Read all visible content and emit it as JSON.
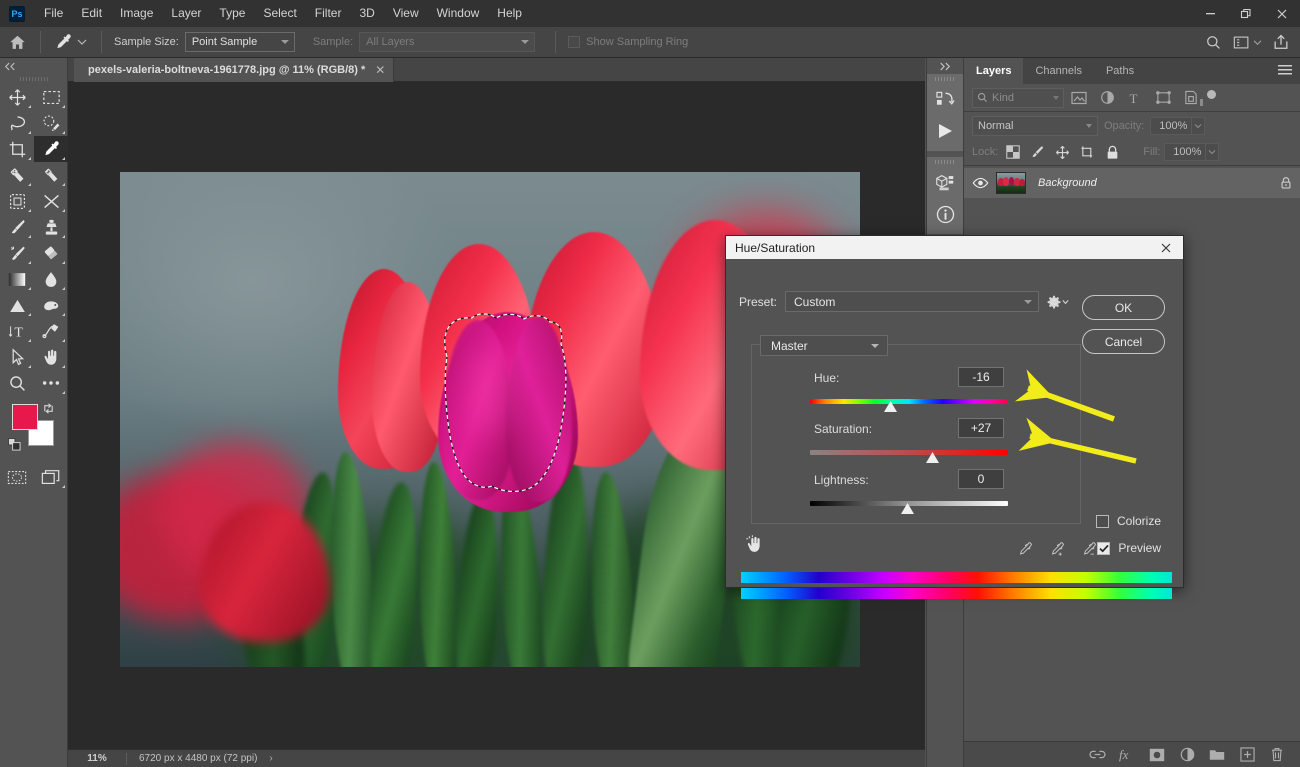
{
  "app": {
    "name": "Ps",
    "menus": [
      "File",
      "Edit",
      "Image",
      "Layer",
      "Type",
      "Select",
      "Filter",
      "3D",
      "View",
      "Window",
      "Help"
    ],
    "window_buttons": {
      "minimize": "minimize-icon",
      "restore": "restore-icon",
      "close": "close-icon"
    }
  },
  "options_bar": {
    "home_icon": "home-icon",
    "tool_icon": "eyedropper-icon",
    "tool_caret": "chevron-down-icon",
    "sample_size_label": "Sample Size:",
    "sample_size_value": "Point Sample",
    "sample_label": "Sample:",
    "sample_value": "All Layers",
    "show_sampling_ring_label": "Show Sampling Ring",
    "show_sampling_ring_checked": false,
    "right_icons": [
      "search-icon",
      "workspace-icon",
      "share-icon"
    ]
  },
  "toolbar": {
    "collapse_icon": "collapse-left-icon",
    "tools": [
      {
        "name": "move-tool",
        "icon": "move-icon",
        "active": false
      },
      {
        "name": "rectangular-marquee-tool",
        "icon": "marquee-icon",
        "active": false
      },
      {
        "name": "lasso-tool",
        "icon": "lasso-icon",
        "active": false
      },
      {
        "name": "object-selection-tool",
        "icon": "quick-selection-icon",
        "active": false
      },
      {
        "name": "crop-tool",
        "icon": "crop-icon",
        "active": false
      },
      {
        "name": "eyedropper-tool",
        "icon": "eyedropper-icon",
        "active": true
      },
      {
        "name": "spot-healing-brush-tool",
        "icon": "healing-brush-icon",
        "active": false
      },
      {
        "name": "patch-tool",
        "icon": "patch-icon",
        "active": false
      },
      {
        "name": "frame-tool",
        "icon": "frame-icon",
        "active": false
      },
      {
        "name": "shuffle-tool",
        "icon": "shuffle-icon",
        "active": false
      },
      {
        "name": "brush-tool",
        "icon": "brush-icon",
        "active": false
      },
      {
        "name": "clone-stamp-tool",
        "icon": "stamp-icon",
        "active": false
      },
      {
        "name": "mixer-brush-tool",
        "icon": "mixer-brush-icon",
        "active": false
      },
      {
        "name": "eraser-tool",
        "icon": "eraser-icon",
        "active": false
      },
      {
        "name": "gradient-tool",
        "icon": "gradient-icon",
        "active": false
      },
      {
        "name": "blur-tool",
        "icon": "blur-drop-icon",
        "active": false
      },
      {
        "name": "dodge-tool",
        "icon": "dodge-triangle-icon",
        "active": false
      },
      {
        "name": "burn-tool",
        "icon": "burn-hand-icon",
        "active": false
      },
      {
        "name": "type-tool",
        "icon": "type-icon",
        "active": false
      },
      {
        "name": "pen-tool",
        "icon": "pen-icon",
        "active": false
      },
      {
        "name": "path-selection-tool",
        "icon": "path-arrow-icon",
        "active": false
      },
      {
        "name": "hand-tool",
        "icon": "hand-icon",
        "active": false
      },
      {
        "name": "zoom-tool",
        "icon": "magnifier-icon",
        "active": false
      },
      {
        "name": "edit-toolbar",
        "icon": "ellipsis-icon",
        "active": false
      },
      {
        "name": "quick-mask-tool",
        "icon": "quick-mask-icon",
        "active": false
      },
      {
        "name": "screen-mode-tool",
        "icon": "screen-mode-icon",
        "active": false
      }
    ],
    "foreground_color": "#e8184c",
    "background_color": "#ffffff",
    "swap_icon": "swap-colors-icon",
    "default_icon": "default-colors-icon"
  },
  "document": {
    "tab_title": "pexels-valeria-boltneva-1961778.jpg @ 11% (RGB/8) *",
    "tab_close_icon": "close-icon"
  },
  "status_bar": {
    "zoom": "11%",
    "dimensions": "6720 px x 4480 px (72 ppi)",
    "expand_icon": "chevron-right-icon"
  },
  "rail": {
    "collapse_icon": "collapse-right-icon",
    "items": [
      {
        "name": "rail-libraries",
        "icon": "actions-icon"
      },
      {
        "name": "rail-play",
        "icon": "play-icon"
      },
      {
        "name": "rail-3d",
        "icon": "cube-icon"
      },
      {
        "name": "rail-info",
        "icon": "info-icon"
      },
      {
        "name": "rail-properties",
        "icon": "properties-icon"
      }
    ]
  },
  "layers_panel": {
    "tabs": [
      {
        "label": "Layers",
        "active": true
      },
      {
        "label": "Channels",
        "active": false
      },
      {
        "label": "Paths",
        "active": false
      }
    ],
    "menu_icon": "panel-menu-icon",
    "filter": {
      "search_icon": "search-icon",
      "kind_label": "Kind",
      "buttons": [
        "pixel-filter-icon",
        "adjustment-filter-icon",
        "type-filter-icon",
        "shape-filter-icon",
        "smart-object-filter-icon"
      ],
      "toggle_icon": "filter-toggle-icon"
    },
    "blend_mode": "Normal",
    "opacity_label": "Opacity:",
    "opacity_value": "100%",
    "lock_label": "Lock:",
    "lock_buttons": [
      "lock-transparency-icon",
      "lock-image-icon",
      "lock-position-icon",
      "lock-artboard-icon",
      "lock-all-icon"
    ],
    "fill_label": "Fill:",
    "fill_value": "100%",
    "layers": [
      {
        "name": "Background",
        "visible": true,
        "locked": true,
        "visibility_icon": "eye-icon",
        "lock_icon": "lock-icon"
      }
    ],
    "footer_buttons": [
      {
        "name": "link-layers-button",
        "icon": "link-icon"
      },
      {
        "name": "layer-style-button",
        "icon": "fx-icon"
      },
      {
        "name": "layer-mask-button",
        "icon": "mask-icon"
      },
      {
        "name": "adjustment-layer-button",
        "icon": "half-circle-icon"
      },
      {
        "name": "new-group-button",
        "icon": "folder-icon"
      },
      {
        "name": "new-layer-button",
        "icon": "plus-square-icon"
      },
      {
        "name": "delete-layer-button",
        "icon": "trash-icon"
      }
    ]
  },
  "dialog": {
    "title": "Hue/Saturation",
    "close_icon": "close-icon",
    "preset_label": "Preset:",
    "preset_value": "Custom",
    "preset_gear_icon": "gear-icon",
    "ok_label": "OK",
    "cancel_label": "Cancel",
    "channel_value": "Master",
    "sliders": [
      {
        "name": "hue",
        "label": "Hue:",
        "value": "-16",
        "thumb_pct": 41
      },
      {
        "name": "saturation",
        "label": "Saturation:",
        "value": "+27",
        "thumb_pct": 62
      },
      {
        "name": "lightness",
        "label": "Lightness:",
        "value": "0",
        "thumb_pct": 49
      }
    ],
    "target_adjust_icon": "on-image-adjust-icon",
    "eyedroppers": [
      "eyedropper-icon",
      "eyedropper-plus-icon",
      "eyedropper-minus-icon"
    ],
    "colorize_label": "Colorize",
    "colorize_checked": false,
    "preview_label": "Preview",
    "preview_checked": true
  },
  "annotations": {
    "arrow_color": "#f2ec1b",
    "arrows": [
      {
        "name": "arrow-to-hue-slider"
      },
      {
        "name": "arrow-to-saturation-slider"
      }
    ]
  },
  "colors": {
    "chrome": "#535353",
    "menubar": "#323232",
    "canvas": "#2a2a2a",
    "accent_blue": "#31a8ff"
  }
}
